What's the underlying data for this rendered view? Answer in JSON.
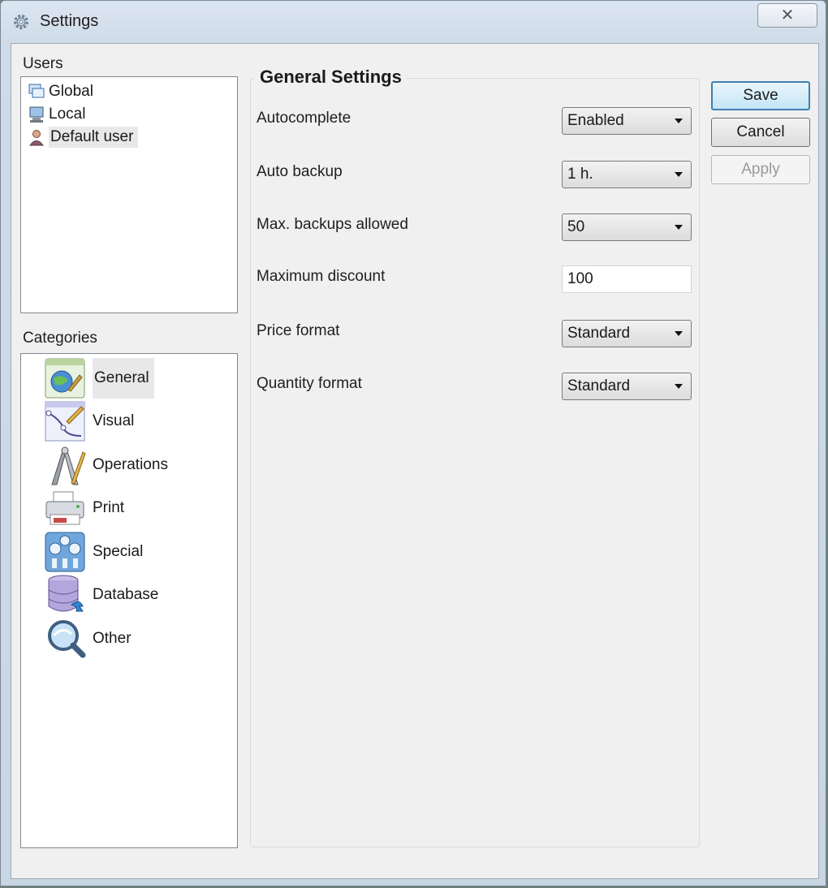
{
  "window": {
    "title": "Settings",
    "close_glyph": "✕"
  },
  "users": {
    "label": "Users",
    "items": [
      {
        "label": "Global",
        "icon": "global-users-icon"
      },
      {
        "label": "Local",
        "icon": "computer-icon"
      },
      {
        "label": "Default user",
        "icon": "user-icon",
        "selected": true
      }
    ]
  },
  "categories": {
    "label": "Categories",
    "items": [
      {
        "label": "General",
        "icon": "general-icon",
        "selected": true
      },
      {
        "label": "Visual",
        "icon": "visual-icon"
      },
      {
        "label": "Operations",
        "icon": "operations-icon"
      },
      {
        "label": "Print",
        "icon": "printer-icon"
      },
      {
        "label": "Special",
        "icon": "special-icon"
      },
      {
        "label": "Database",
        "icon": "database-icon"
      },
      {
        "label": "Other",
        "icon": "magnifier-icon"
      }
    ]
  },
  "general": {
    "title": "General Settings",
    "fields": [
      {
        "label": "Autocomplete",
        "type": "combo",
        "value": "Enabled"
      },
      {
        "label": "Auto backup",
        "type": "combo",
        "value": "1 h."
      },
      {
        "label": "Max. backups allowed",
        "type": "combo",
        "value": "50"
      },
      {
        "label": "Maximum discount",
        "type": "text",
        "value": "100"
      },
      {
        "label": "Price format",
        "type": "combo",
        "value": "Standard"
      },
      {
        "label": "Quantity format",
        "type": "combo",
        "value": "Standard"
      }
    ]
  },
  "buttons": {
    "save": "Save",
    "cancel": "Cancel",
    "apply": "Apply"
  }
}
